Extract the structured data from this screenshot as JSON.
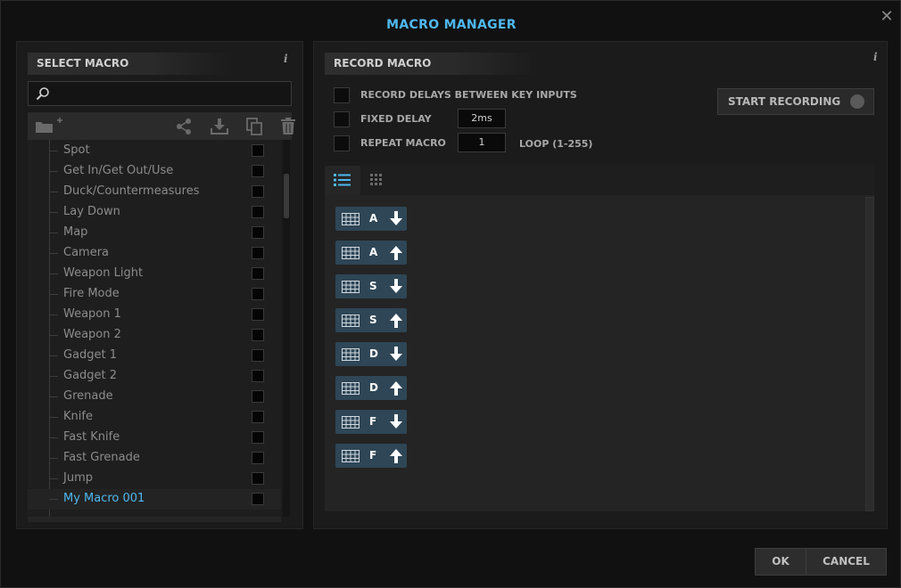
{
  "window": {
    "title": "MACRO MANAGER",
    "close_label": "✕"
  },
  "select_macro": {
    "header": "SELECT MACRO",
    "info_label": "i",
    "search": {
      "value": "",
      "placeholder": ""
    },
    "items": [
      {
        "label": "Spot",
        "selected": false
      },
      {
        "label": "Get In/Get Out/Use",
        "selected": false
      },
      {
        "label": "Duck/Countermeasures",
        "selected": false
      },
      {
        "label": "Lay Down",
        "selected": false
      },
      {
        "label": "Map",
        "selected": false
      },
      {
        "label": "Camera",
        "selected": false
      },
      {
        "label": "Weapon Light",
        "selected": false
      },
      {
        "label": "Fire Mode",
        "selected": false
      },
      {
        "label": "Weapon 1",
        "selected": false
      },
      {
        "label": "Weapon 2",
        "selected": false
      },
      {
        "label": "Gadget 1",
        "selected": false
      },
      {
        "label": "Gadget 2",
        "selected": false
      },
      {
        "label": "Grenade",
        "selected": false
      },
      {
        "label": "Knife",
        "selected": false
      },
      {
        "label": "Fast Knife",
        "selected": false
      },
      {
        "label": "Fast Grenade",
        "selected": false
      },
      {
        "label": "Jump",
        "selected": false
      },
      {
        "label": "My Macro 001",
        "selected": true
      }
    ]
  },
  "record_macro": {
    "header": "RECORD MACRO",
    "info_label": "i",
    "options": {
      "record_delays_label": "RECORD DELAYS BETWEEN KEY INPUTS",
      "fixed_delay_label": "FIXED DELAY",
      "fixed_delay_value": "2ms",
      "repeat_macro_label": "REPEAT MACRO",
      "repeat_value": "1",
      "loop_label": "LOOP (1-255)"
    },
    "start_recording_label": "START RECORDING",
    "events": [
      {
        "key": "A",
        "direction": "down"
      },
      {
        "key": "A",
        "direction": "up"
      },
      {
        "key": "S",
        "direction": "down"
      },
      {
        "key": "S",
        "direction": "up"
      },
      {
        "key": "D",
        "direction": "down"
      },
      {
        "key": "D",
        "direction": "up"
      },
      {
        "key": "F",
        "direction": "down"
      },
      {
        "key": "F",
        "direction": "up"
      }
    ]
  },
  "footer": {
    "ok_label": "OK",
    "cancel_label": "CANCEL"
  },
  "colors": {
    "accent": "#4fb8ee",
    "event_bg": "#2e4656",
    "panel_bg": "#1b1b1b"
  }
}
